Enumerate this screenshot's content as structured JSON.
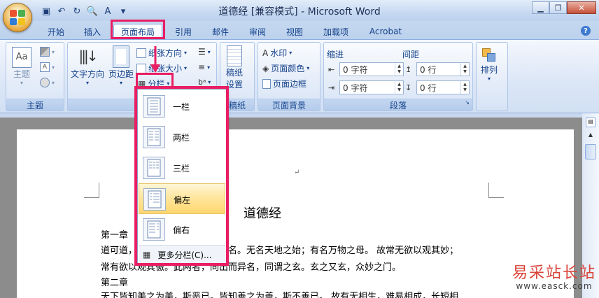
{
  "titlebar": {
    "title": "道德经 [兼容模式] - Microsoft Word",
    "qat_icons": [
      "save-icon",
      "undo-icon",
      "redo-icon",
      "print-preview-icon",
      "spelling-icon",
      "customize-icon"
    ],
    "window_buttons": [
      "minimize-icon",
      "restore-icon",
      "close-icon"
    ]
  },
  "tabs": [
    {
      "label": "开始"
    },
    {
      "label": "插入"
    },
    {
      "label": "页面布局",
      "active": true
    },
    {
      "label": "引用"
    },
    {
      "label": "邮件"
    },
    {
      "label": "审阅"
    },
    {
      "label": "视图"
    },
    {
      "label": "加载项"
    },
    {
      "label": "Acrobat"
    }
  ],
  "ribbon": {
    "theme_group": {
      "label": "主题",
      "button": "主题"
    },
    "page_setup_group": {
      "label": "页面设置",
      "text_direction": "文字方向",
      "margins": "页边距",
      "orientation": "纸张方向",
      "size": "纸张大小",
      "columns": "分栏",
      "label_visible": "页面"
    },
    "draft_group": {
      "label": "稿纸",
      "button_line1": "稿纸",
      "button_line2": "设置"
    },
    "background_group": {
      "label": "页面背景",
      "watermark": "水印",
      "page_color": "页面颜色",
      "page_border": "页面边框"
    },
    "paragraph_group": {
      "label": "段落",
      "indent_label": "缩进",
      "spacing_label": "间距",
      "indent_left": "0 字符",
      "indent_right": "0 字符",
      "spacing_before": "0 行",
      "spacing_after": "0 行"
    },
    "arrange_group": {
      "button": "排列"
    }
  },
  "columns_menu": {
    "items": [
      {
        "label": "一栏",
        "icon": "one-column-icon"
      },
      {
        "label": "两栏",
        "icon": "two-columns-icon"
      },
      {
        "label": "三栏",
        "icon": "three-columns-icon"
      },
      {
        "label": "偏左",
        "icon": "left-column-icon",
        "selected": true
      },
      {
        "label": "偏右",
        "icon": "right-column-icon"
      }
    ],
    "more": "更多分栏(C)..."
  },
  "document": {
    "heading": "道德经",
    "lines": [
      "第一章",
      "道可道，非常道；名可名，非常名。无名天地之始；有名万物之母。 故常无欲以观其妙；",
      "常有欲以观其徼。此两者，同出而异名，同谓之玄。玄之又玄，众妙之门。",
      "第二章",
      "天下皆知美之为美，斯恶已。皆知善之为善，斯不善已。 故有无相生，难易相成，长短相"
    ],
    "para_mark": "↵"
  },
  "watermark": {
    "line1": "易采站长站",
    "line2": "www.easck.com"
  },
  "colors": {
    "highlight": "#e91e63",
    "ribbon_text": "#15428b"
  }
}
